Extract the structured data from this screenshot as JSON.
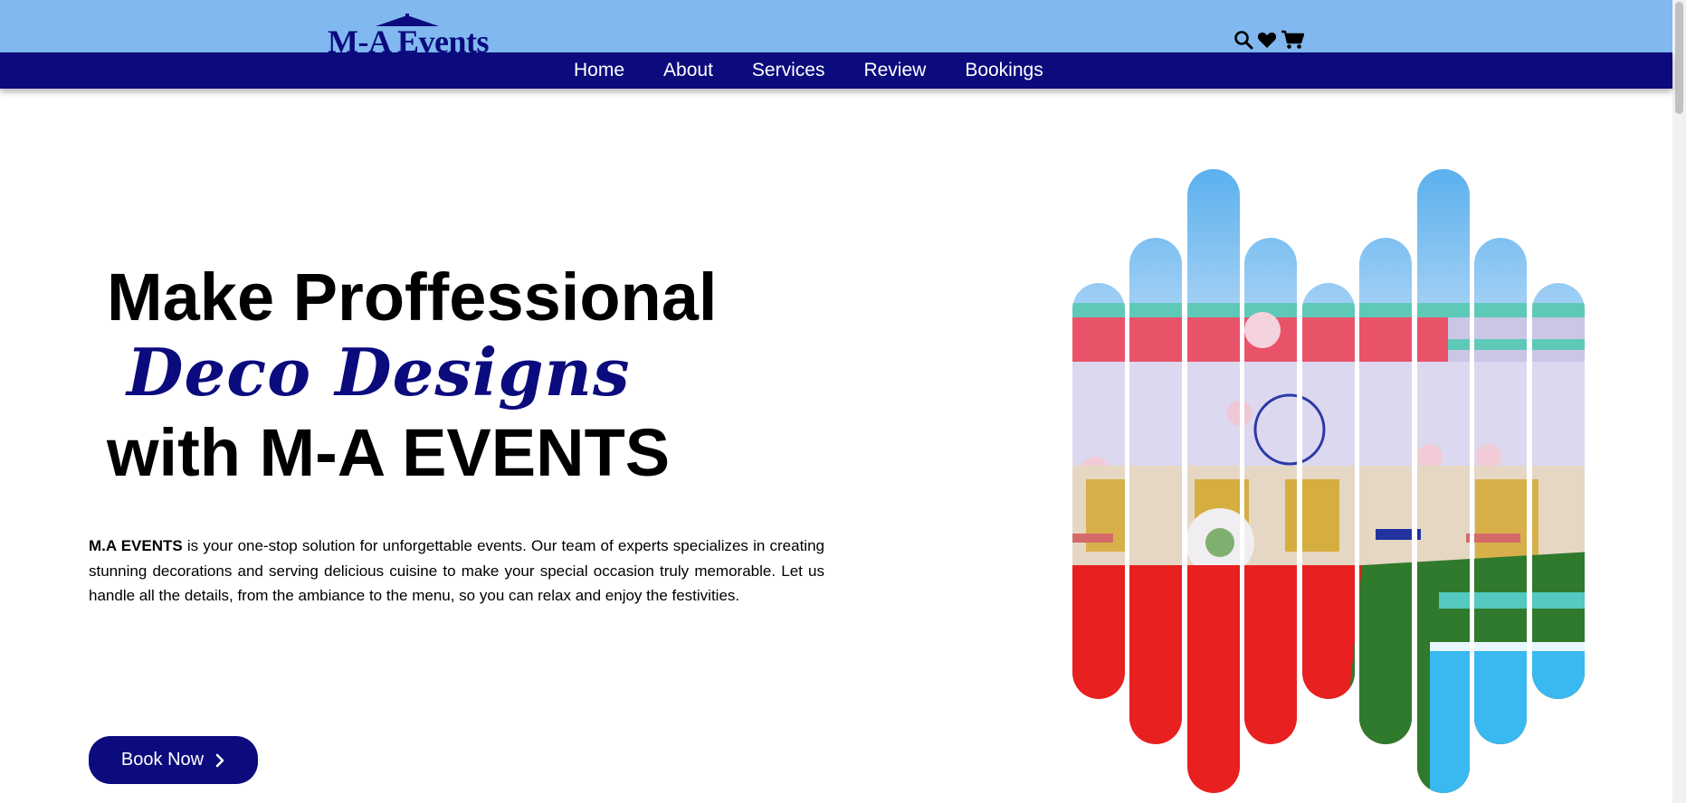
{
  "brand": {
    "logo_text": "M-A Events"
  },
  "nav": {
    "items": [
      "Home",
      "About",
      "Services",
      "Review",
      "Bookings"
    ]
  },
  "header_icons": [
    "search-icon",
    "heart-icon",
    "cart-icon"
  ],
  "hero": {
    "title_line1": "Make Proffessional",
    "title_line2": "Deco Designs",
    "title_line3": "with M-A EVENTS",
    "desc_brand": "M.A EVENTS",
    "desc_text": " is your one-stop solution for unforgettable events. Our team of experts specializes in creating stunning decorations and serving delicious cuisine to make your special occasion truly memorable. Let us handle all the details, from the ambiance to the menu, so you can relax and enjoy the festivities.",
    "cta_label": "Book Now"
  },
  "colors": {
    "topbar": "#80b8ef",
    "navbar": "#0b0b7e",
    "accent": "#0b0b7e",
    "carpet": "#e8201f",
    "grass": "#2f7a2c",
    "pool": "#39b9f0"
  }
}
